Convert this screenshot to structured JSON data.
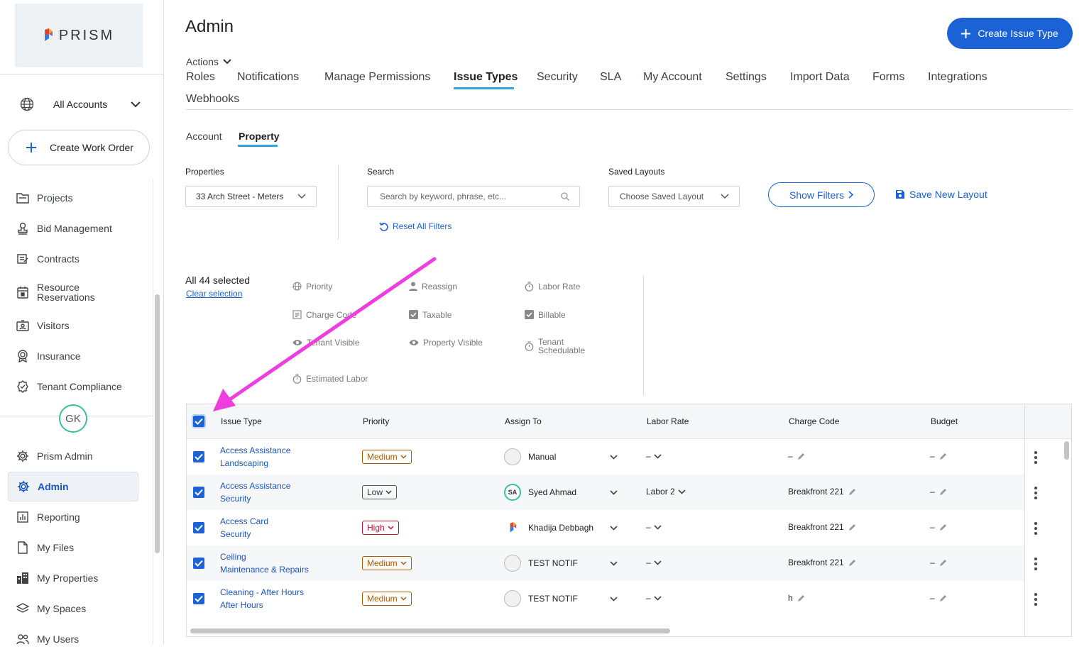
{
  "sidebar": {
    "logo_text": "PRISM",
    "account_selector": "All Accounts",
    "create_work_order": "Create Work Order",
    "nav_top": [
      {
        "label": "Projects",
        "icon": "folder-icon"
      },
      {
        "label": "Bid Management",
        "icon": "stamp-icon"
      },
      {
        "label": "Contracts",
        "icon": "contract-icon"
      },
      {
        "label": "Resource Reservations",
        "icon": "calendar-icon"
      },
      {
        "label": "Visitors",
        "icon": "badge-icon"
      },
      {
        "label": "Insurance",
        "icon": "award-icon"
      },
      {
        "label": "Tenant Compliance",
        "icon": "verified-icon"
      }
    ],
    "user_initials": "GK",
    "nav_bottom": [
      {
        "label": "Prism Admin",
        "icon": "gear-icon"
      },
      {
        "label": "Admin",
        "icon": "gear-icon",
        "active": true
      },
      {
        "label": "Reporting",
        "icon": "chart-icon"
      },
      {
        "label": "My Files",
        "icon": "file-icon"
      },
      {
        "label": "My Properties",
        "icon": "building-icon"
      },
      {
        "label": "My Spaces",
        "icon": "layers-icon"
      },
      {
        "label": "My Users",
        "icon": "users-icon"
      }
    ]
  },
  "header": {
    "title": "Admin",
    "create_button": "Create Issue Type",
    "actions": "Actions"
  },
  "tabs": [
    "Roles",
    "Notifications",
    "Manage Permissions",
    "Issue Types",
    "Security",
    "SLA",
    "My Account",
    "Settings",
    "Import Data",
    "Forms",
    "Integrations",
    "Webhooks"
  ],
  "active_tab": "Issue Types",
  "subtabs": [
    "Account",
    "Property"
  ],
  "active_subtab": "Property",
  "filters": {
    "properties_label": "Properties",
    "properties_value": "33 Arch Street - Meters",
    "search_label": "Search",
    "search_placeholder": "Search by keyword, phrase, etc...",
    "reset": "Reset All Filters",
    "saved_layouts_label": "Saved Layouts",
    "saved_layouts_value": "Choose Saved Layout",
    "show_filters": "Show Filters",
    "save_layout": "Save New Layout"
  },
  "selection": {
    "count_text": "All 44 selected",
    "clear": "Clear selection"
  },
  "bulk_actions": [
    {
      "label": "Priority",
      "icon": "globe-icon"
    },
    {
      "label": "Reassign",
      "icon": "person-icon"
    },
    {
      "label": "Labor Rate",
      "icon": "timer-icon"
    },
    {
      "label": "Charge Code",
      "icon": "receipt-icon"
    },
    {
      "label": "Taxable",
      "icon": "checkbox-icon"
    },
    {
      "label": "Billable",
      "icon": "checkbox-icon"
    },
    {
      "label": "Tenant Visible",
      "icon": "eye-icon"
    },
    {
      "label": "Property Visible",
      "icon": "eye-icon"
    },
    {
      "label": "Tenant Schedulable",
      "icon": "timer-icon"
    },
    {
      "label": "Estimated Labor",
      "icon": "timer-icon"
    }
  ],
  "table": {
    "columns": [
      "Issue Type",
      "Priority",
      "Assign To",
      "Labor Rate",
      "Charge Code",
      "Budget"
    ],
    "rows": [
      {
        "type1": "Access Assistance",
        "type2": "Landscaping",
        "priority": "Medium",
        "assignee": "Manual",
        "assignee_avatar": "",
        "labor": "–",
        "charge": "–",
        "budget": "–"
      },
      {
        "type1": "Access Assistance",
        "type2": "Security",
        "priority": "Low",
        "assignee": "Syed Ahmad",
        "assignee_avatar": "SA",
        "labor": "Labor 2",
        "charge": "Breakfront 221",
        "budget": "–"
      },
      {
        "type1": "Access Card",
        "type2": "Security",
        "priority": "High",
        "assignee": "Khadija Debbagh",
        "assignee_avatar": "logo",
        "labor": "–",
        "charge": "Breakfront 221",
        "budget": "–"
      },
      {
        "type1": "Ceiling",
        "type2": "Maintenance & Repairs",
        "priority": "Medium",
        "assignee": "TEST NOTIF",
        "assignee_avatar": "",
        "labor": "–",
        "charge": "Breakfront 221",
        "budget": "–"
      },
      {
        "type1": "Cleaning - After Hours",
        "type2": "After Hours",
        "priority": "Medium",
        "assignee": "TEST NOTIF",
        "assignee_avatar": "",
        "labor": "–",
        "charge": "h",
        "budget": "–"
      }
    ]
  },
  "colors": {
    "primary": "#1a62d6",
    "annotation_arrow": "#f03de0",
    "medium": "#b25b00",
    "high": "#c8102e"
  }
}
